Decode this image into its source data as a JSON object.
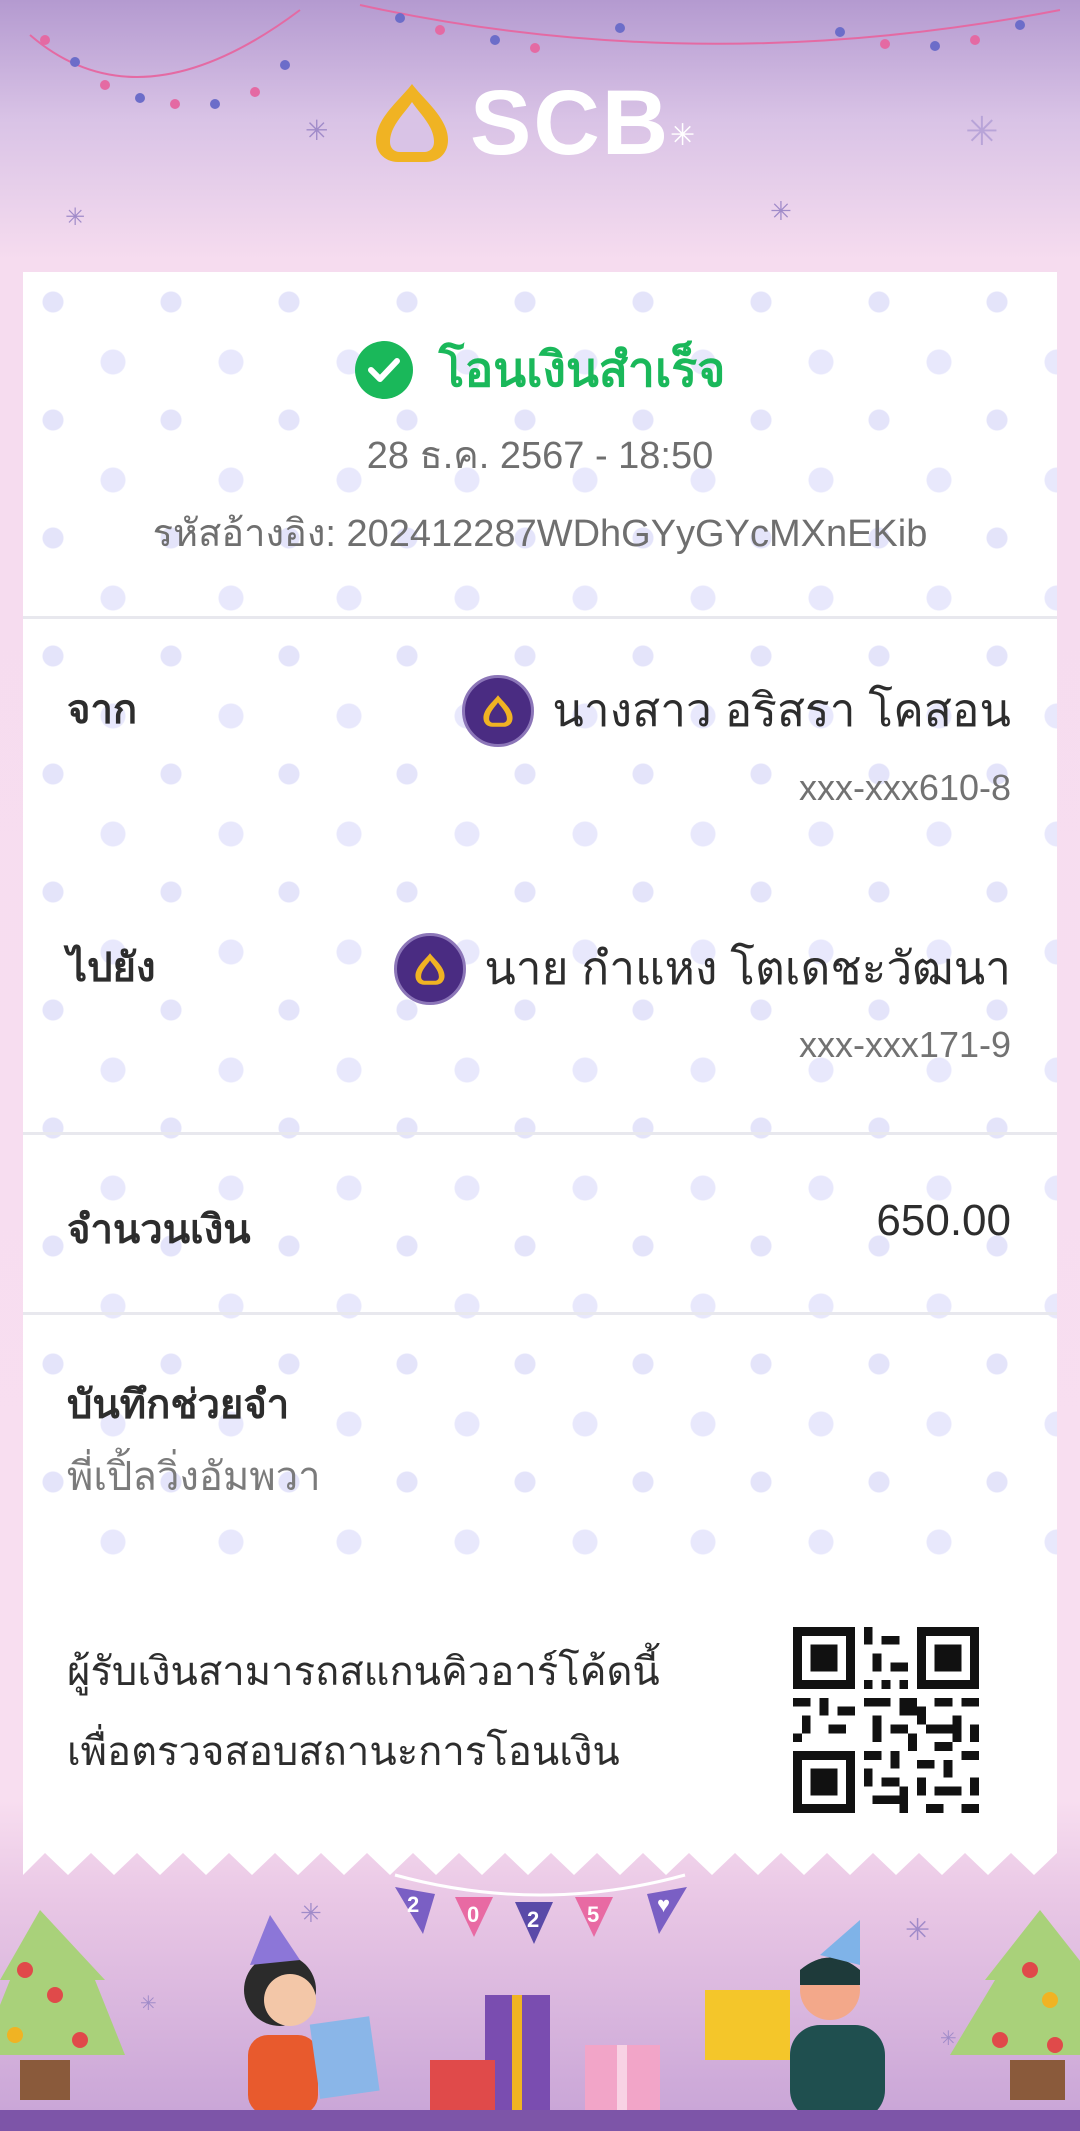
{
  "brand": {
    "name": "SCB"
  },
  "status": {
    "title": "โอนเงินสำเร็จ",
    "datetime": "28 ธ.ค. 2567 - 18:50",
    "reference": "รหัสอ้างอิง: 202412287WDhGYyGYcMXnEKib"
  },
  "from": {
    "label": "จาก",
    "name": "นางสาว อริสรา โคสอน",
    "account": "xxx-xxx610-8"
  },
  "to": {
    "label": "ไปยัง",
    "name": "นาย กำแหง โตเดชะวัฒนา",
    "account": "xxx-xxx171-9"
  },
  "amount": {
    "label": "จำนวนเงิน",
    "value": "650.00"
  },
  "memo": {
    "label": "บันทึกช่วยจำ",
    "value": "พี่เปิ้ลวิ่งอัมพวา"
  },
  "qr": {
    "line1": "ผู้รับเงินสามารถสแกนคิวอาร์โค้ดนี้",
    "line2": "เพื่อตรวจสอบสถานะการโอนเงิน"
  },
  "footer": {
    "bunting": [
      "2",
      "0",
      "2",
      "5",
      "♥"
    ]
  },
  "colors": {
    "brand_purple": "#4a2c82",
    "success_green": "#1ab85a",
    "logo_gold": "#f0b323"
  },
  "icons": [
    "scb-logo-icon",
    "check-circle-icon",
    "scb-account-icon",
    "qr-code-icon"
  ]
}
